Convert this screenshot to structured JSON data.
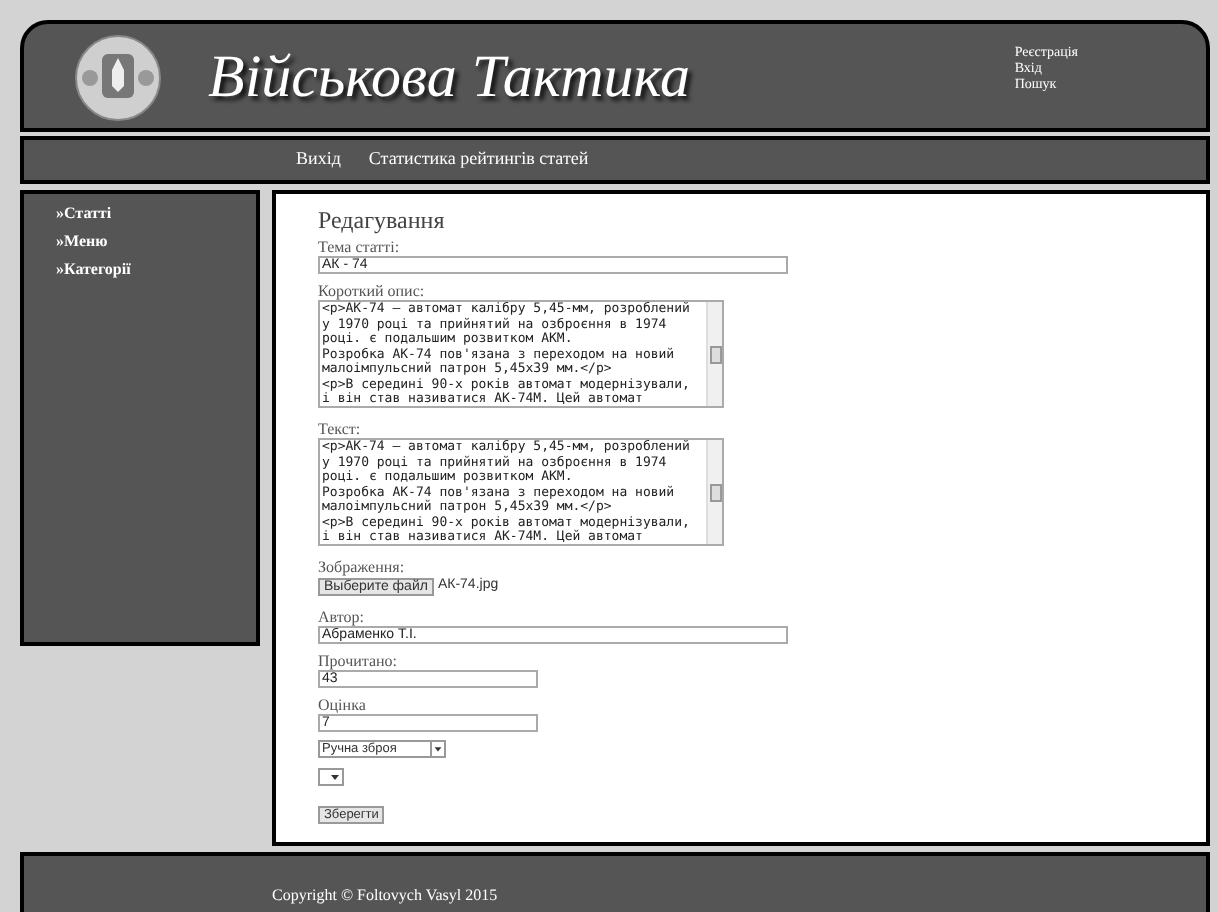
{
  "header": {
    "title": "Військова Тактика",
    "links": [
      "Реєстрація",
      "Вхід",
      "Пошук"
    ]
  },
  "nav": [
    "Вихід",
    "Статистика рейтингів статей"
  ],
  "sidebar": {
    "items": [
      "»Статті",
      "»Меню",
      "»Категорії"
    ]
  },
  "form": {
    "heading": "Редагування",
    "title_field": {
      "label": "Тема статті:",
      "value": "АК - 74"
    },
    "summary_field": {
      "label": "Короткий опис:",
      "value": "<p>АК-74 – автомат калібру 5,45-мм, розроблений у 1970 році та прийнятий на озброєння в 1974 році. є подальшим розвитком АКМ.\nРозробка АК-74 пов'язана з переходом на новий малоімпульсний патрон 5,45х39 мм.</p>\n<p>В середині 90-х років автомат модернізували, і він став називатися АК-74М. Цей автомат"
    },
    "text_field": {
      "label": "Текст:",
      "value": "<p>АК-74 – автомат калібру 5,45-мм, розроблений у 1970 році та прийнятий на озброєння в 1974 році. є подальшим розвитком АКМ.\nРозробка АК-74 пов'язана з переходом на новий малоімпульсний патрон 5,45х39 мм.</p>\n<p>В середині 90-х років автомат модернізували, і він став називатися АК-74М. Цей автомат"
    },
    "image_field": {
      "label": "Зображення:",
      "button": "Выберите файл",
      "file": "АК-74.jpg"
    },
    "author_field": {
      "label": "Автор:",
      "value": "Абраменко Т.І."
    },
    "views_field": {
      "label": "Прочитано:",
      "value": "43"
    },
    "rating_field": {
      "label": "Оцінка",
      "value": "7"
    },
    "category_select": {
      "value": "Ручна зброя"
    },
    "submit": "Зберегти"
  },
  "footer": "Copyright © Foltovych Vasyl 2015"
}
